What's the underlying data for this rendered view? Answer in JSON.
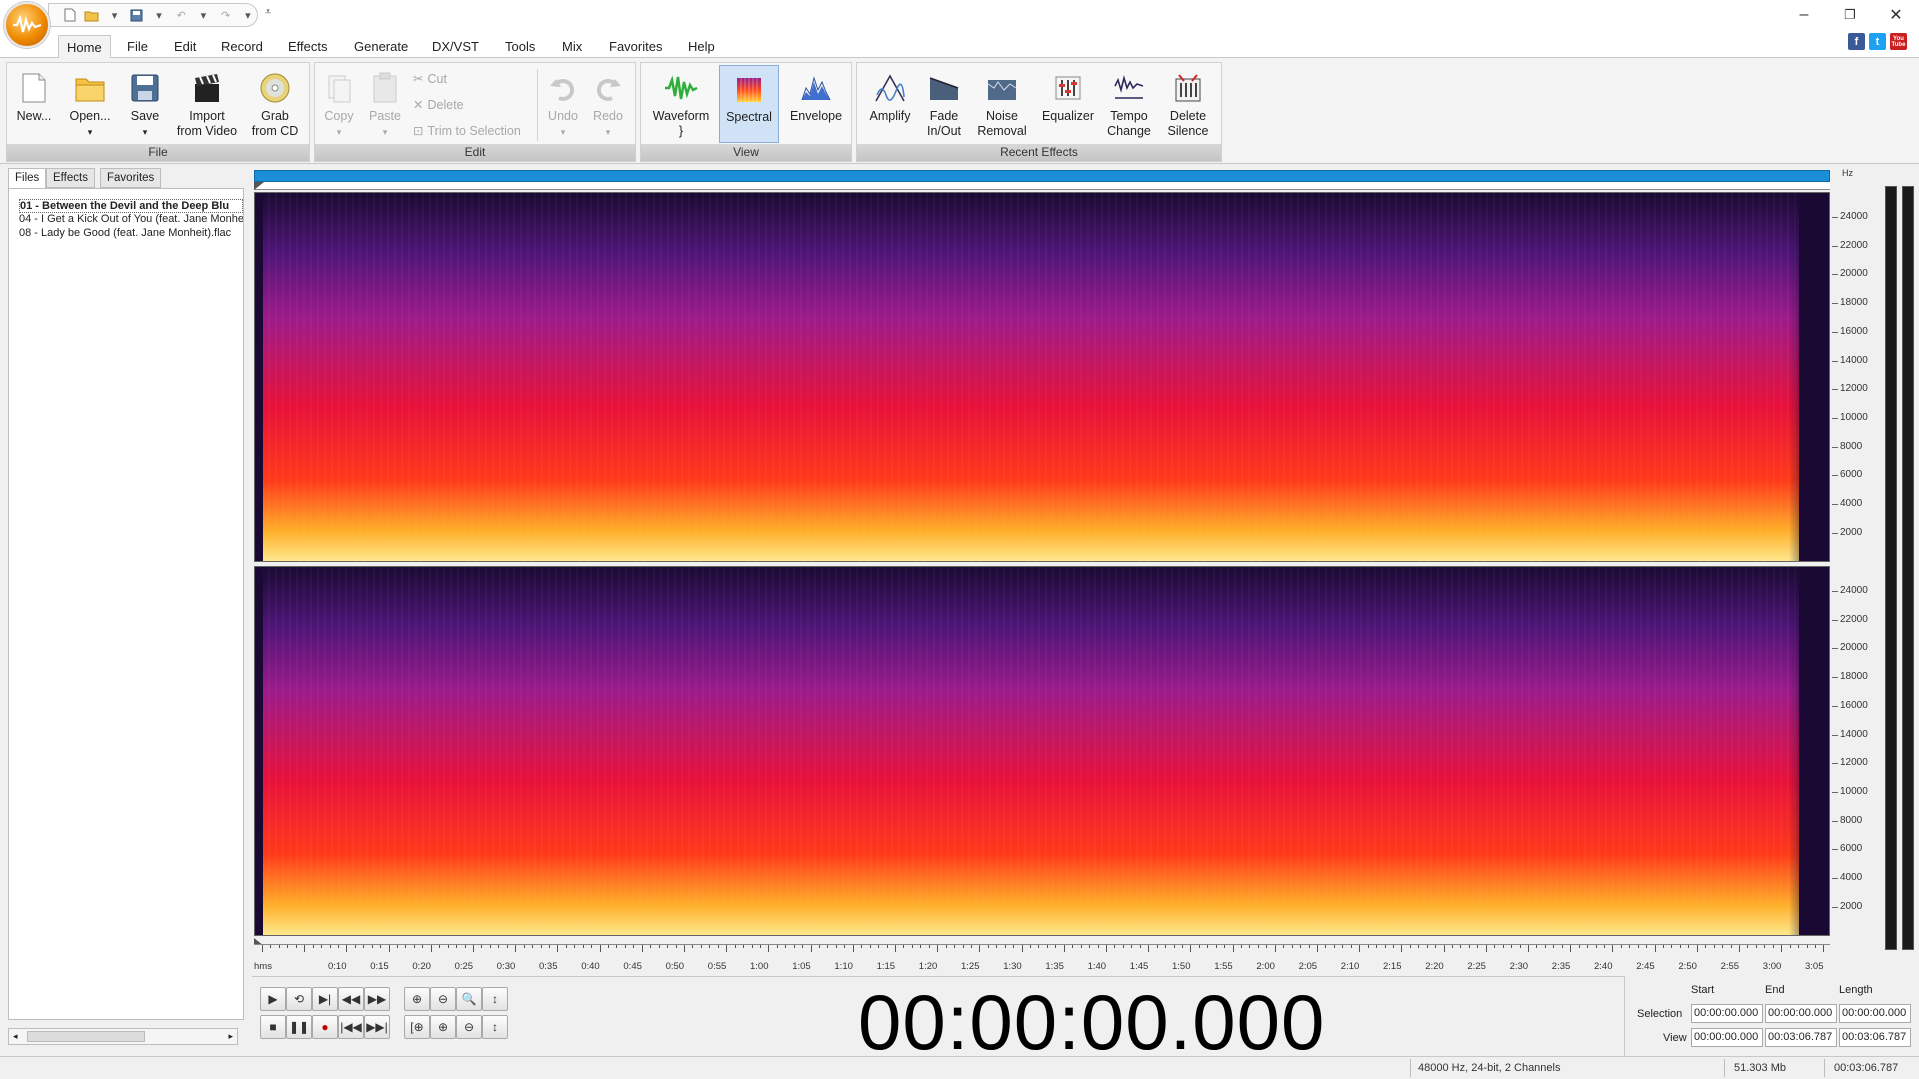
{
  "window": {
    "controls": {
      "minimize": "–",
      "restore": "❐",
      "close": "✕"
    }
  },
  "menu": {
    "tabs": [
      "Home",
      "File",
      "Edit",
      "Record",
      "Effects",
      "Generate",
      "DX/VST",
      "Tools",
      "Mix",
      "Favorites",
      "Help"
    ],
    "active": "Home"
  },
  "social": {
    "facebook": "f",
    "twitter": "t",
    "youtube": "You Tube"
  },
  "ribbon": {
    "file": {
      "label": "File",
      "new": "New...",
      "open": "Open...",
      "save": "Save",
      "import_line1": "Import",
      "import_line2": "from Video",
      "grab_line1": "Grab",
      "grab_line2": "from CD"
    },
    "edit": {
      "label": "Edit",
      "copy": "Copy",
      "paste": "Paste",
      "cut": "Cut",
      "delete": "Delete",
      "trim": "Trim to Selection",
      "undo": "Undo",
      "redo": "Redo"
    },
    "view": {
      "label": "View",
      "waveform": "Waveform",
      "spectral": "Spectral",
      "envelope": "Envelope"
    },
    "recent": {
      "label": "Recent Effects",
      "amplify": "Amplify",
      "fade_line1": "Fade",
      "fade_line2": "In/Out",
      "noise_line1": "Noise",
      "noise_line2": "Removal",
      "equalizer": "Equalizer",
      "tempo_line1": "Tempo",
      "tempo_line2": "Change",
      "delsil_line1": "Delete",
      "delsil_line2": "Silence"
    }
  },
  "panel": {
    "tabs": [
      "Files",
      "Effects",
      "Favorites"
    ],
    "files": [
      "01 - Between the Devil and the Deep Blu",
      "04 - I Get a Kick Out of You (feat. Jane Monhe",
      "08 - Lady be Good (feat. Jane Monheit).flac"
    ]
  },
  "spectrogram": {
    "hz_unit": "Hz",
    "hz_labels": [
      "24000",
      "22000",
      "20000",
      "18000",
      "16000",
      "14000",
      "12000",
      "10000",
      "8000",
      "6000",
      "4000",
      "2000"
    ],
    "time_unit": "hms",
    "time_labels": [
      "0:10",
      "0:15",
      "0:20",
      "0:25",
      "0:30",
      "0:35",
      "0:40",
      "0:45",
      "0:50",
      "0:55",
      "1:00",
      "1:05",
      "1:10",
      "1:15",
      "1:20",
      "1:25",
      "1:30",
      "1:35",
      "1:40",
      "1:45",
      "1:50",
      "1:55",
      "2:00",
      "2:05",
      "2:10",
      "2:15",
      "2:20",
      "2:25",
      "2:30",
      "2:35",
      "2:40",
      "2:45",
      "2:50",
      "2:55",
      "3:00",
      "3:05"
    ],
    "colors": {
      "low": "#ffe88c",
      "mid": "#ff3a1a",
      "high": "#9d1b8a",
      "bg": "#1a0a33"
    }
  },
  "clock": "00:00:00.000",
  "selection": {
    "headers": {
      "start": "Start",
      "end": "End",
      "length": "Length"
    },
    "selection_label": "Selection",
    "view_label": "View",
    "selection": {
      "start": "00:00:00.000",
      "end": "00:00:00.000",
      "length": "00:00:00.000"
    },
    "view": {
      "start": "00:00:00.000",
      "end": "00:03:06.787",
      "length": "00:03:06.787"
    }
  },
  "status": {
    "format": "48000 Hz, 24-bit, 2 Channels",
    "size": "51.303 Mb",
    "duration": "00:03:06.787"
  }
}
